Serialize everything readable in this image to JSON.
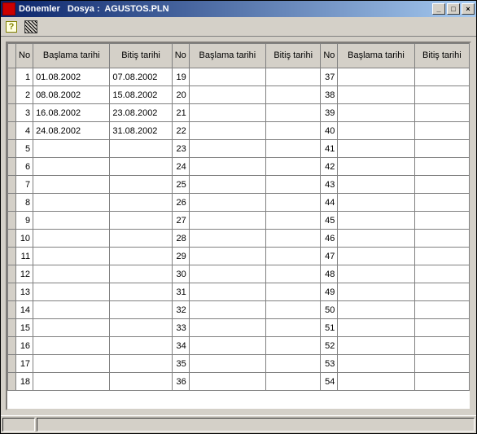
{
  "title": "Dönemler   Dosya :  AGUSTOS.PLN",
  "winbtns": {
    "min": "_",
    "max": "□",
    "close": "×"
  },
  "headers": {
    "no": "No",
    "start": "Başlama tarihi",
    "end": "Bitiş tarihi"
  },
  "rows_per_block": 18,
  "blocks": [
    [
      {
        "no": 1,
        "start": "01.08.2002",
        "end": "07.08.2002"
      },
      {
        "no": 2,
        "start": "08.08.2002",
        "end": "15.08.2002"
      },
      {
        "no": 3,
        "start": "16.08.2002",
        "end": "23.08.2002"
      },
      {
        "no": 4,
        "start": "24.08.2002",
        "end": "31.08.2002"
      },
      {
        "no": 5,
        "start": "",
        "end": ""
      },
      {
        "no": 6,
        "start": "",
        "end": ""
      },
      {
        "no": 7,
        "start": "",
        "end": ""
      },
      {
        "no": 8,
        "start": "",
        "end": ""
      },
      {
        "no": 9,
        "start": "",
        "end": ""
      },
      {
        "no": 10,
        "start": "",
        "end": ""
      },
      {
        "no": 11,
        "start": "",
        "end": ""
      },
      {
        "no": 12,
        "start": "",
        "end": ""
      },
      {
        "no": 13,
        "start": "",
        "end": ""
      },
      {
        "no": 14,
        "start": "",
        "end": ""
      },
      {
        "no": 15,
        "start": "",
        "end": ""
      },
      {
        "no": 16,
        "start": "",
        "end": ""
      },
      {
        "no": 17,
        "start": "",
        "end": ""
      },
      {
        "no": 18,
        "start": "",
        "end": ""
      }
    ],
    [
      {
        "no": 19,
        "start": "",
        "end": ""
      },
      {
        "no": 20,
        "start": "",
        "end": ""
      },
      {
        "no": 21,
        "start": "",
        "end": ""
      },
      {
        "no": 22,
        "start": "",
        "end": ""
      },
      {
        "no": 23,
        "start": "",
        "end": ""
      },
      {
        "no": 24,
        "start": "",
        "end": ""
      },
      {
        "no": 25,
        "start": "",
        "end": ""
      },
      {
        "no": 26,
        "start": "",
        "end": ""
      },
      {
        "no": 27,
        "start": "",
        "end": ""
      },
      {
        "no": 28,
        "start": "",
        "end": ""
      },
      {
        "no": 29,
        "start": "",
        "end": ""
      },
      {
        "no": 30,
        "start": "",
        "end": ""
      },
      {
        "no": 31,
        "start": "",
        "end": ""
      },
      {
        "no": 32,
        "start": "",
        "end": ""
      },
      {
        "no": 33,
        "start": "",
        "end": ""
      },
      {
        "no": 34,
        "start": "",
        "end": ""
      },
      {
        "no": 35,
        "start": "",
        "end": ""
      },
      {
        "no": 36,
        "start": "",
        "end": ""
      }
    ],
    [
      {
        "no": 37,
        "start": "",
        "end": ""
      },
      {
        "no": 38,
        "start": "",
        "end": ""
      },
      {
        "no": 39,
        "start": "",
        "end": ""
      },
      {
        "no": 40,
        "start": "",
        "end": ""
      },
      {
        "no": 41,
        "start": "",
        "end": ""
      },
      {
        "no": 42,
        "start": "",
        "end": ""
      },
      {
        "no": 43,
        "start": "",
        "end": ""
      },
      {
        "no": 44,
        "start": "",
        "end": ""
      },
      {
        "no": 45,
        "start": "",
        "end": ""
      },
      {
        "no": 46,
        "start": "",
        "end": ""
      },
      {
        "no": 47,
        "start": "",
        "end": ""
      },
      {
        "no": 48,
        "start": "",
        "end": ""
      },
      {
        "no": 49,
        "start": "",
        "end": ""
      },
      {
        "no": 50,
        "start": "",
        "end": ""
      },
      {
        "no": 51,
        "start": "",
        "end": ""
      },
      {
        "no": 52,
        "start": "",
        "end": ""
      },
      {
        "no": 53,
        "start": "",
        "end": ""
      },
      {
        "no": 54,
        "start": "",
        "end": ""
      }
    ]
  ]
}
